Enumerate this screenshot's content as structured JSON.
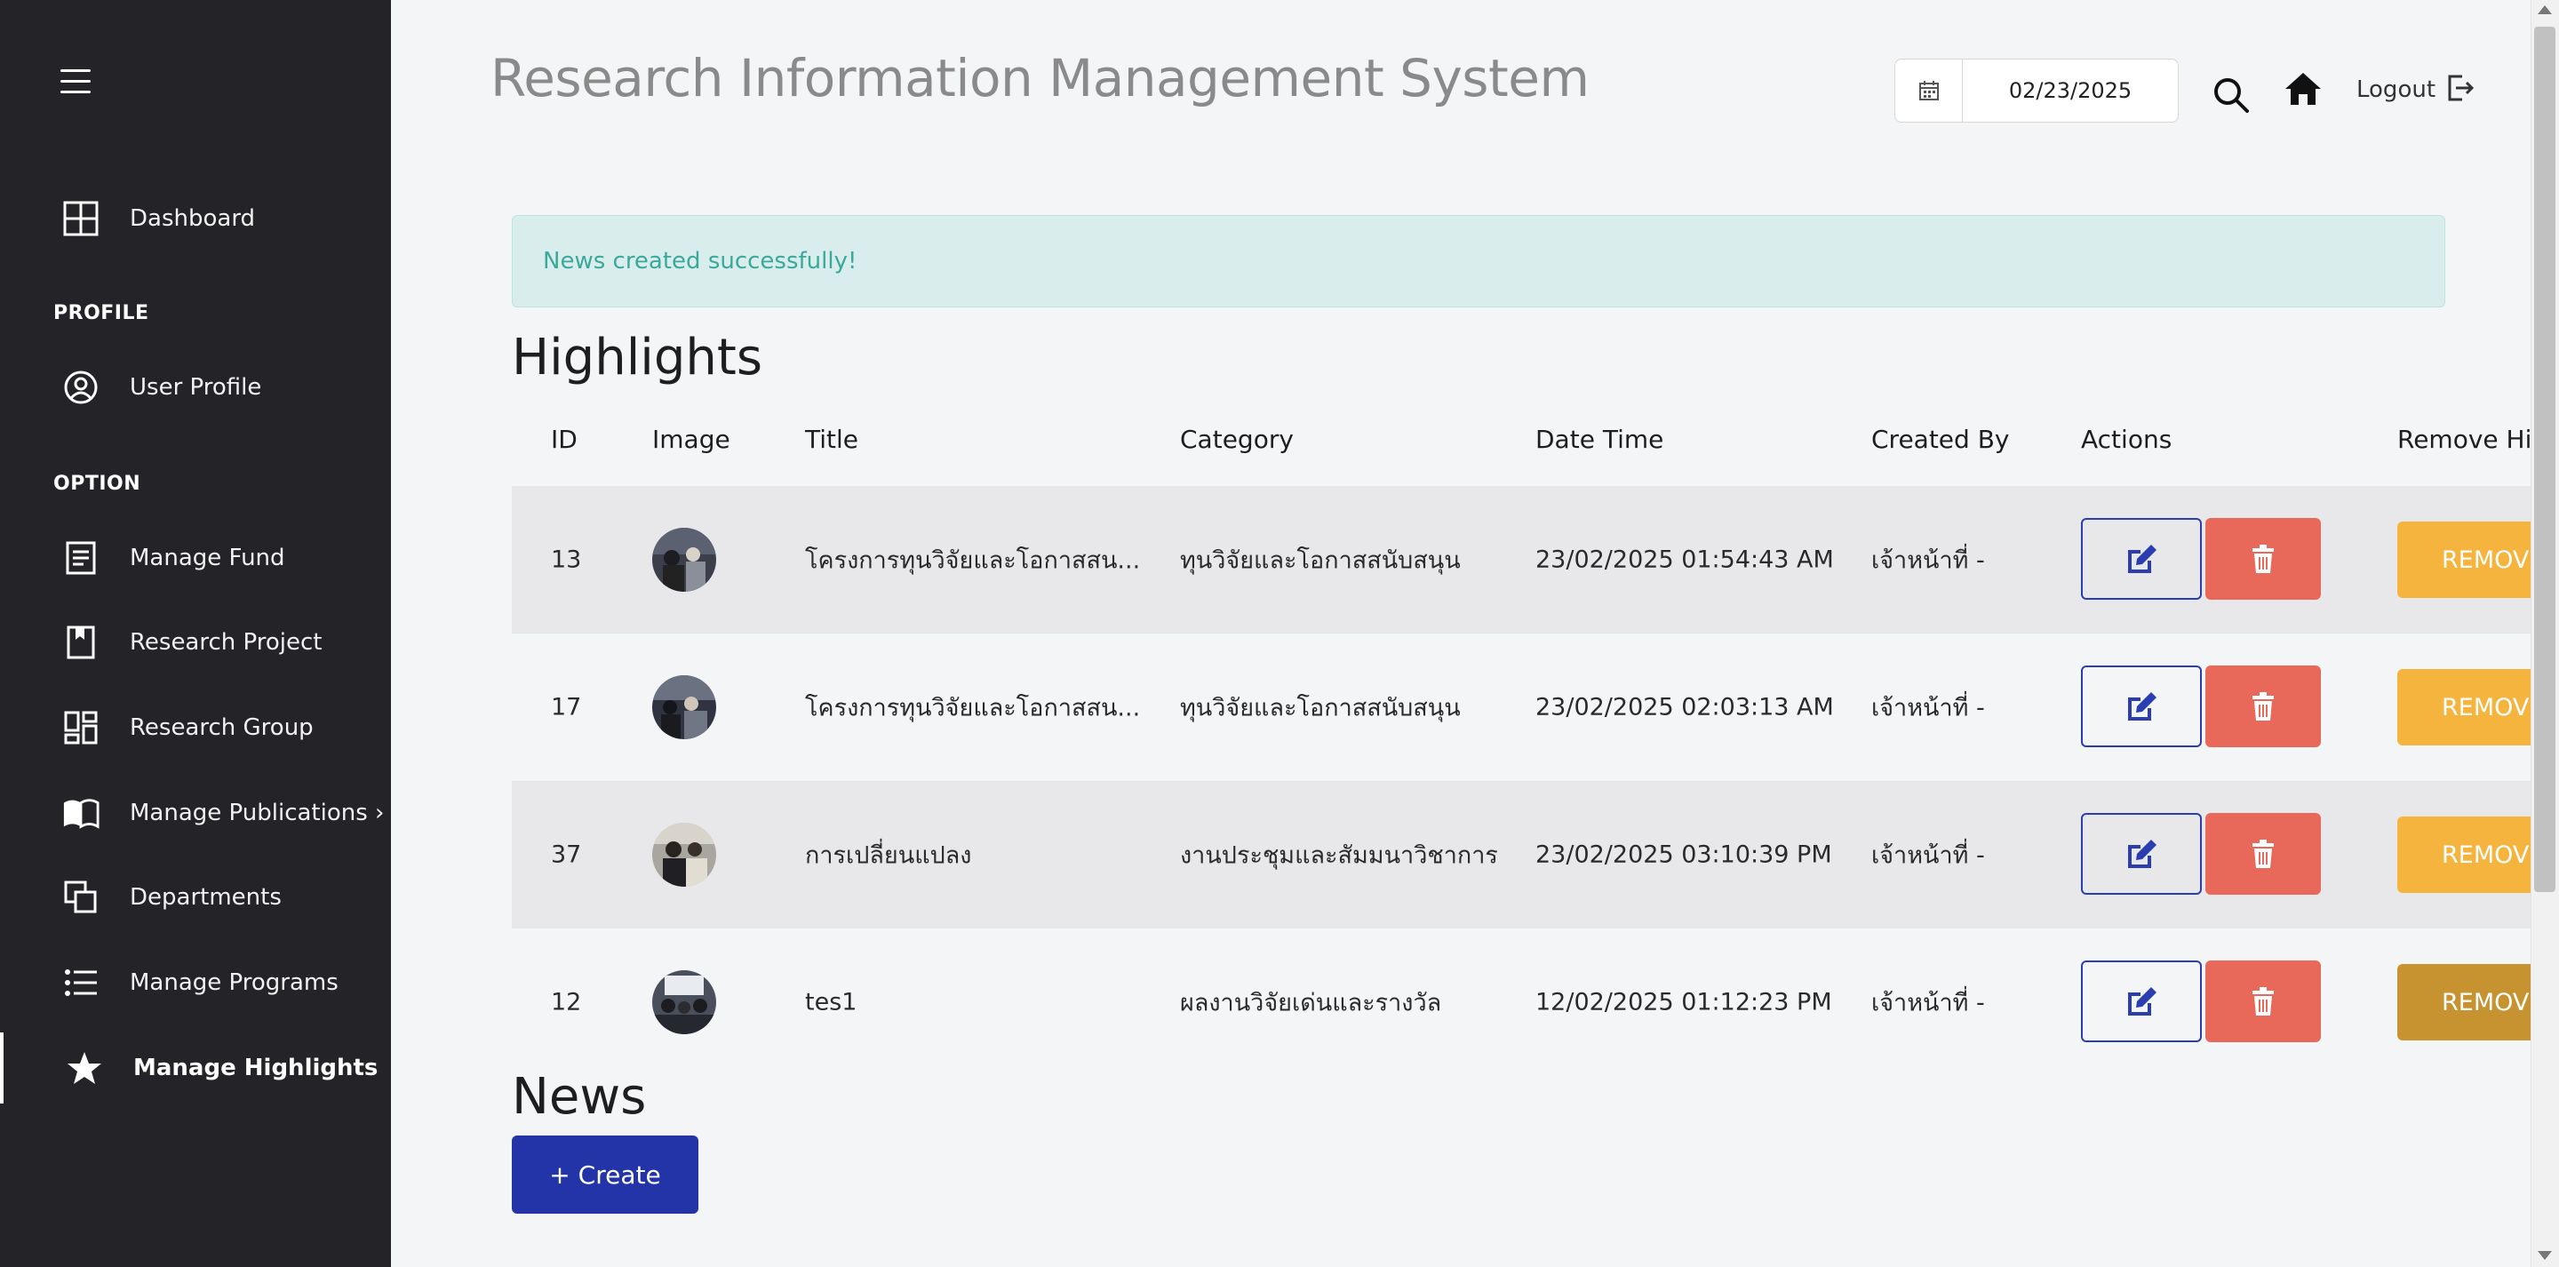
{
  "sidebar": {
    "items": [
      {
        "label": "Dashboard",
        "icon": "dashboard-icon"
      },
      {
        "label": "User Profile",
        "icon": "user-circle-icon"
      },
      {
        "label": "Manage Fund",
        "icon": "document-icon"
      },
      {
        "label": "Research Project",
        "icon": "bookmark-icon"
      },
      {
        "label": "Research Group",
        "icon": "grid-icon"
      },
      {
        "label": "Manage Publications ›",
        "icon": "open-book-icon"
      },
      {
        "label": "Departments",
        "icon": "copy-icon"
      },
      {
        "label": "Manage Programs",
        "icon": "list-icon"
      },
      {
        "label": "Manage Highlights",
        "icon": "star-icon"
      }
    ],
    "sections": {
      "profile": "PROFILE",
      "option": "OPTION"
    }
  },
  "header": {
    "title": "Research Information Management System",
    "date_value": "02/23/2025",
    "logout_label": "Logout"
  },
  "alert": {
    "message": "News created successfully!"
  },
  "highlights": {
    "title": "Highlights",
    "columns": [
      "ID",
      "Image",
      "Title",
      "Category",
      "Date Time",
      "Created By",
      "Actions",
      "Remove Hig"
    ],
    "rows": [
      {
        "id": "13",
        "title": "โครงการทุนวิจัยและโอกาสสน...",
        "category": "ทุนวิจัยและโอกาสสนับสนุน",
        "datetime": "23/02/2025 01:54:43 AM",
        "created_by": "เจ้าหน้าที่ -",
        "remove": "REMOVE"
      },
      {
        "id": "17",
        "title": "โครงการทุนวิจัยและโอกาสสน...",
        "category": "ทุนวิจัยและโอกาสสนับสนุน",
        "datetime": "23/02/2025 02:03:13 AM",
        "created_by": "เจ้าหน้าที่ -",
        "remove": "REMOVE"
      },
      {
        "id": "37",
        "title": "การเปลี่ยนแปลง",
        "category": "งานประชุมและสัมมนาวิชาการ",
        "datetime": "23/02/2025 03:10:39 PM",
        "created_by": "เจ้าหน้าที่ -",
        "remove": "REMOVE"
      },
      {
        "id": "12",
        "title": "tes1",
        "category": "ผลงานวิจัยเด่นและรางวัล",
        "datetime": "12/02/2025 01:12:23 PM",
        "created_by": "เจ้าหน้าที่ -",
        "remove": "REMOVE"
      }
    ]
  },
  "news": {
    "title": "News",
    "create_label": "+ Create"
  },
  "colors": {
    "sidebar_bg": "#232328",
    "primary": "#2334a8",
    "danger": "#e8695a",
    "warning": "#f4b43e",
    "alert_bg": "#d9eeec",
    "alert_text": "#3aa89b"
  }
}
